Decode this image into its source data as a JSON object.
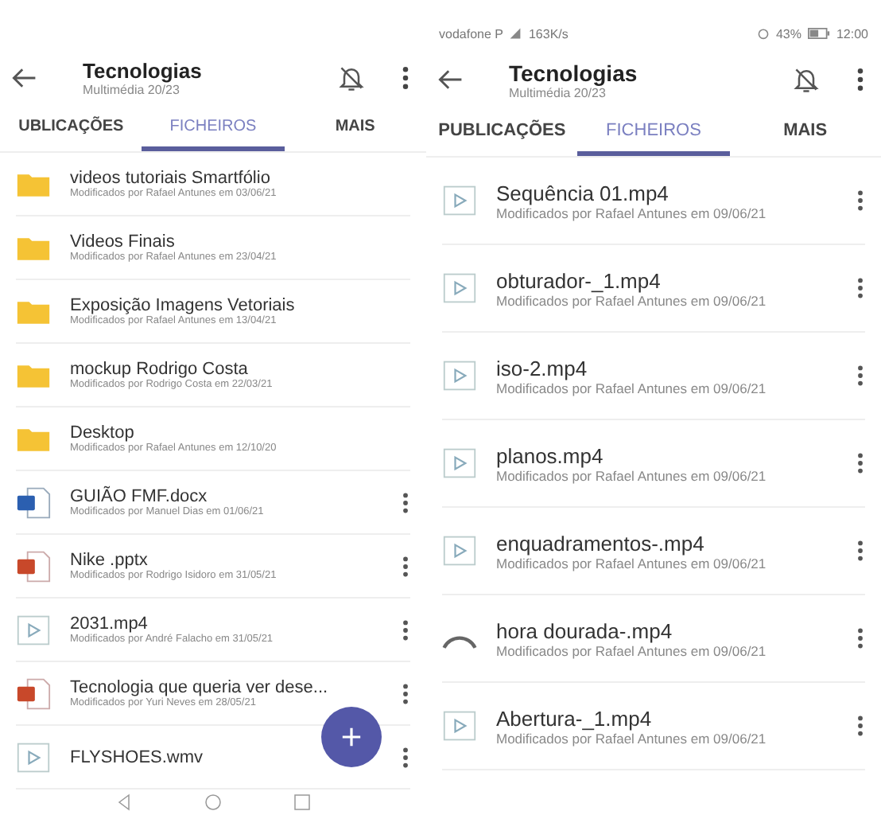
{
  "panels": [
    {
      "header": {
        "title": "Tecnologias",
        "subtitle": "Multimédia 20/23"
      },
      "tabs": [
        {
          "label": "UBLICAÇÕES",
          "selected": false
        },
        {
          "label": "FICHEIROS",
          "selected": true
        },
        {
          "label": "MAIS",
          "selected": false
        }
      ],
      "files": [
        {
          "kind": "folder",
          "name": "videos tutoriais Smartfólio",
          "detail": "Modificados por Rafael Antunes em 03/06/21",
          "menu": false
        },
        {
          "kind": "folder",
          "name": "Videos Finais",
          "detail": "Modificados por Rafael Antunes em 23/04/21",
          "menu": false
        },
        {
          "kind": "folder",
          "name": "Exposição Imagens Vetoriais",
          "detail": "Modificados por Rafael Antunes em 13/04/21",
          "menu": false
        },
        {
          "kind": "folder",
          "name": "mockup Rodrigo Costa",
          "detail": "Modificados por Rodrigo Costa em 22/03/21",
          "menu": false
        },
        {
          "kind": "folder",
          "name": "Desktop",
          "detail": "Modificados por Rafael Antunes em 12/10/20",
          "menu": false
        },
        {
          "kind": "word",
          "name": "GUIÃO FMF.docx",
          "detail": "Modificados por Manuel Dias em 01/06/21",
          "menu": true
        },
        {
          "kind": "slides",
          "name": "Nike .pptx",
          "detail": "Modificados por Rodrigo Isidoro em 31/05/21",
          "menu": true
        },
        {
          "kind": "video",
          "name": "2031.mp4",
          "detail": "Modificados por André Falacho em 31/05/21",
          "menu": true
        },
        {
          "kind": "slides",
          "name": "Tecnologia que queria ver dese...",
          "detail": "Modificados por Yuri Neves em 28/05/21",
          "menu": true
        },
        {
          "kind": "video",
          "name": "FLYSHOES.wmv",
          "menu": true
        }
      ],
      "fab": true,
      "nav_bar": true
    },
    {
      "status_bar": {
        "carrier": "vodafone P",
        "speed": "163K/s",
        "battery": "43%",
        "time": "12:00"
      },
      "header": {
        "title": "Tecnologias",
        "subtitle": "Multimédia 20/23"
      },
      "tabs": [
        {
          "label": "PUBLICAÇÕES",
          "selected": false
        },
        {
          "label": "FICHEIROS",
          "selected": true
        },
        {
          "label": "MAIS",
          "selected": false
        }
      ],
      "files": [
        {
          "kind": "video",
          "name": "Sequência 01.mp4",
          "detail": "Modificados por Rafael Antunes em 09/06/21",
          "menu": true
        },
        {
          "kind": "video",
          "name": "obturador-_1.mp4",
          "detail": "Modificados por Rafael Antunes em 09/06/21",
          "menu": true
        },
        {
          "kind": "video",
          "name": "iso-2.mp4",
          "detail": "Modificados por Rafael Antunes em 09/06/21",
          "menu": true
        },
        {
          "kind": "video",
          "name": "planos.mp4",
          "detail": "Modificados por Rafael Antunes em 09/06/21",
          "menu": true
        },
        {
          "kind": "video",
          "name": "enquadramentos-.mp4",
          "detail": "Modificados por Rafael Antunes em 09/06/21",
          "menu": true
        },
        {
          "kind": "loading",
          "name": "hora dourada-.mp4",
          "detail": "Modificados por Rafael Antunes em 09/06/21",
          "menu": true
        },
        {
          "kind": "video",
          "name": "Abertura-_1.mp4",
          "detail": "Modificados por Rafael Antunes em 09/06/21",
          "menu": true
        }
      ]
    }
  ]
}
